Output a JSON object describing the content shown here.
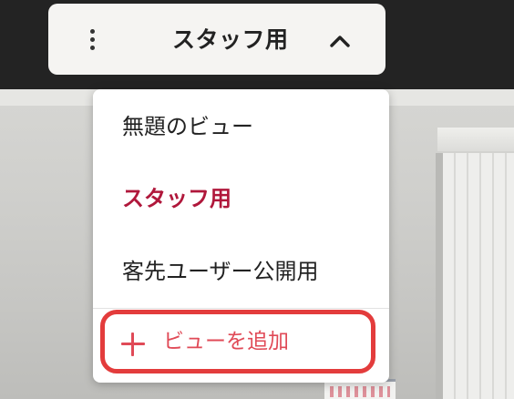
{
  "header": {
    "current_view": "スタッフ用"
  },
  "menu": {
    "items": [
      {
        "label": "無題のビュー",
        "selected": false
      },
      {
        "label": "スタッフ用",
        "selected": true
      },
      {
        "label": "客先ユーザー公開用",
        "selected": false
      }
    ],
    "add_view_label": "ビューを追加"
  },
  "icons": {
    "more": "more-vertical-icon",
    "collapse": "chevron-up-icon",
    "add": "plus-icon"
  },
  "colors": {
    "selected_text": "#b0173b",
    "add_text": "#e04a57",
    "highlight_border": "#e33c3c",
    "top_bar": "#232323",
    "pill_bg": "#f5f4f2"
  }
}
